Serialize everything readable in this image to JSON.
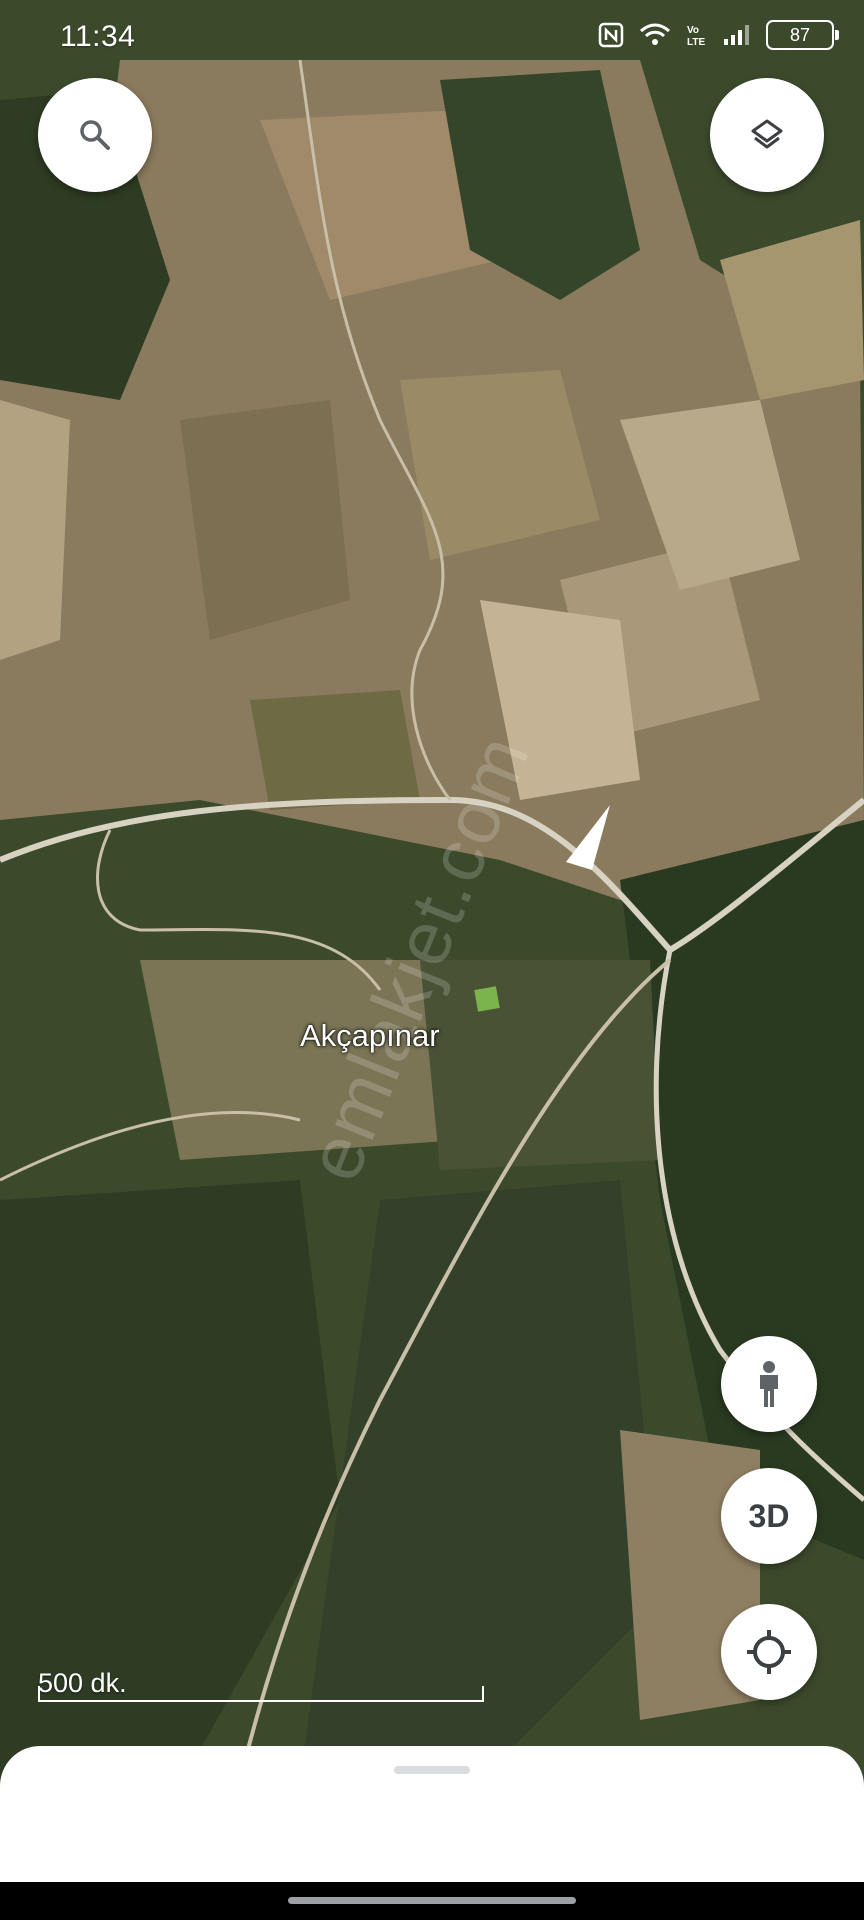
{
  "status_bar": {
    "time": "11:34",
    "battery": "87",
    "icons": [
      "nfc-icon",
      "wifi-icon",
      "volte-icon",
      "signal-icon",
      "battery-icon"
    ]
  },
  "map": {
    "imagery": "satellite",
    "place_label": "Akçapınar",
    "watermark": "emlakjet.com",
    "scale_label": "500 dk.",
    "colors": {
      "forest": "#2f3d24",
      "field": "#8c7a5c",
      "road": "#d8d2c2"
    }
  },
  "controls": {
    "search_icon": "search-icon",
    "layers_icon": "layers-icon",
    "street_view_icon": "pegman-icon",
    "three_d_label": "3D",
    "location_icon": "my-location-icon"
  },
  "bottom_sheet": {
    "handle": "drag-handle"
  }
}
